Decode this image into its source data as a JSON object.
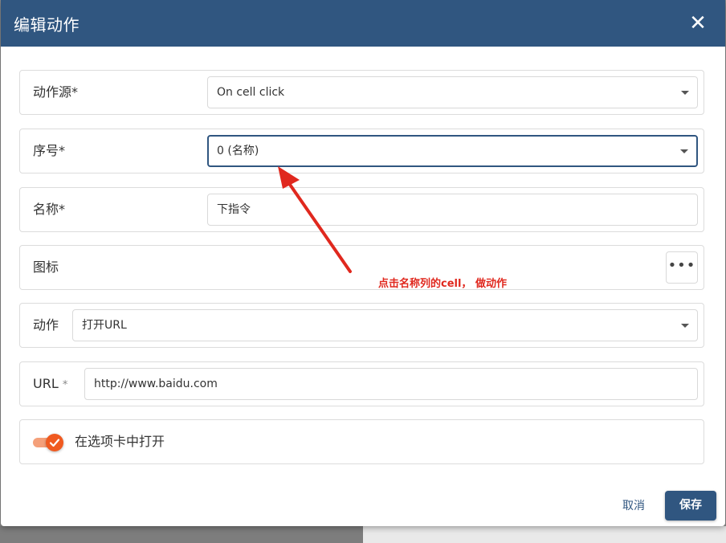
{
  "dialog": {
    "title": "编辑动作",
    "close_label": "✕"
  },
  "fields": {
    "action_source": {
      "label": "动作源",
      "required": "*",
      "value": "On cell click"
    },
    "index": {
      "label": "序号",
      "required": "*",
      "value": "0 (名称)"
    },
    "name": {
      "label": "名称",
      "required": "*",
      "value": "下指令"
    },
    "icon": {
      "label": "图标",
      "button_label": "•••"
    },
    "action": {
      "label": "动作",
      "value": "打开URL"
    },
    "url": {
      "label": "URL",
      "required": "*",
      "value": "http://www.baidu.com"
    },
    "open_in_tab": {
      "label": "在选项卡中打开",
      "checked": true
    }
  },
  "annotation": {
    "text": "点击名称列的cell， 做动作",
    "color": "#e0281e"
  },
  "footer": {
    "cancel_label": "取消",
    "save_label": "保存"
  },
  "colors": {
    "primary": "#305680",
    "toggle_accent": "#f05a20"
  }
}
